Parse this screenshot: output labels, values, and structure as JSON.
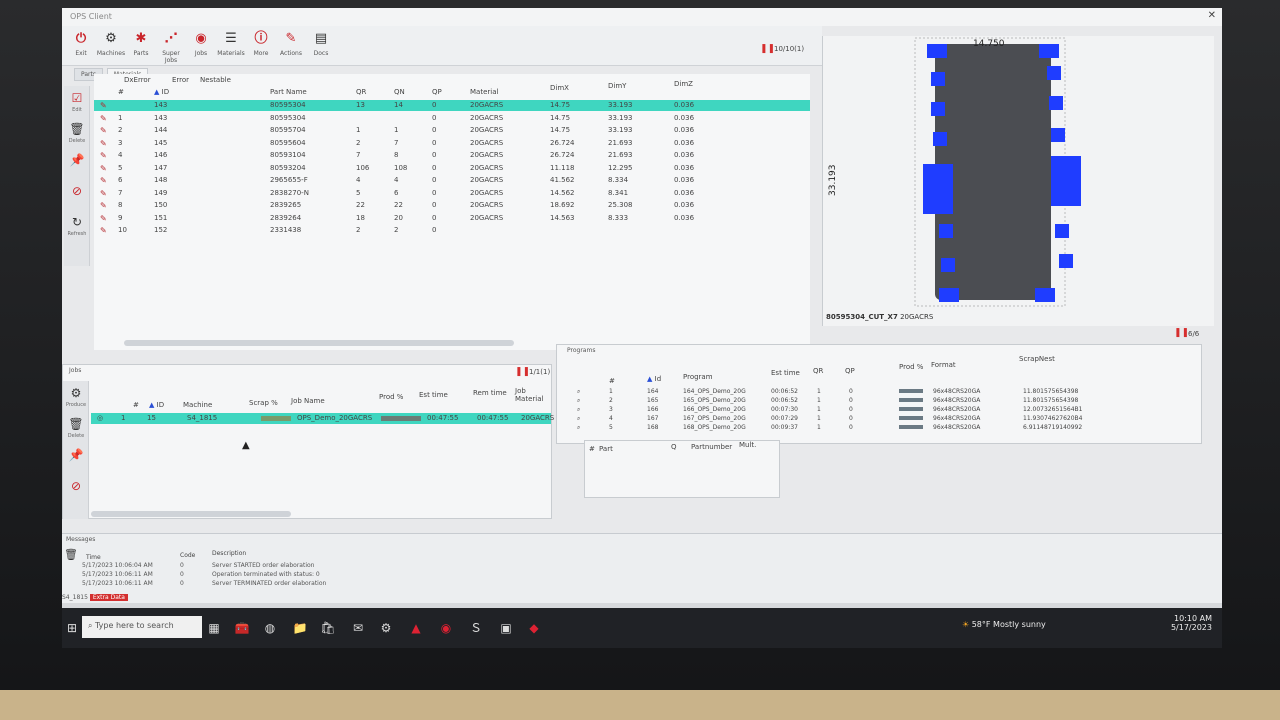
{
  "titlebar": {
    "title": "OPS Client"
  },
  "toolbar": {
    "buttons": [
      {
        "label": "Exit",
        "icon": "power-icon"
      },
      {
        "label": "Machines",
        "icon": "machines-icon"
      },
      {
        "label": "Parts",
        "icon": "parts-icon"
      },
      {
        "label": "Super Jobs",
        "icon": "superjobs-icon"
      },
      {
        "label": "Jobs",
        "icon": "jobs-icon"
      },
      {
        "label": "Materials",
        "icon": "materials-icon"
      },
      {
        "label": "More",
        "icon": "more-icon"
      },
      {
        "label": "Actions",
        "icon": "actions-icon"
      },
      {
        "label": "Docs",
        "icon": "docs-icon"
      }
    ]
  },
  "parts": {
    "tabs": [
      "Parts",
      "Materials"
    ],
    "filters": [
      "DxError",
      "Error",
      "Nestable"
    ],
    "counter": "10/10(1)",
    "columns": [
      "#",
      "ID",
      "Part Name",
      "QR",
      "QN",
      "QP",
      "Material",
      "DimX",
      "DimY",
      "DimZ"
    ],
    "rows": [
      {
        "n": "",
        "id": "143",
        "name": "80595304",
        "qr": "13",
        "qn": "14",
        "qp": "0",
        "mat": "20GACRS",
        "dx": "14.75",
        "dy": "33.193",
        "dz": "0.036"
      },
      {
        "n": "1",
        "id": "143",
        "name": "80595304",
        "qr": "",
        "qn": "",
        "qp": "0",
        "mat": "20GACRS",
        "dx": "14.75",
        "dy": "33.193",
        "dz": "0.036"
      },
      {
        "n": "2",
        "id": "144",
        "name": "80595704",
        "qr": "1",
        "qn": "1",
        "qp": "0",
        "mat": "20GACRS",
        "dx": "14.75",
        "dy": "33.193",
        "dz": "0.036"
      },
      {
        "n": "3",
        "id": "145",
        "name": "80595604",
        "qr": "2",
        "qn": "7",
        "qp": "0",
        "mat": "20GACRS",
        "dx": "26.724",
        "dy": "21.693",
        "dz": "0.036"
      },
      {
        "n": "4",
        "id": "146",
        "name": "80593104",
        "qr": "7",
        "qn": "8",
        "qp": "0",
        "mat": "20GACRS",
        "dx": "26.724",
        "dy": "21.693",
        "dz": "0.036"
      },
      {
        "n": "5",
        "id": "147",
        "name": "80593204",
        "qr": "106",
        "qn": "108",
        "qp": "0",
        "mat": "20GACRS",
        "dx": "11.118",
        "dy": "12.295",
        "dz": "0.036"
      },
      {
        "n": "6",
        "id": "148",
        "name": "2965655-F",
        "qr": "4",
        "qn": "4",
        "qp": "0",
        "mat": "20GACRS",
        "dx": "41.562",
        "dy": "8.334",
        "dz": "0.036"
      },
      {
        "n": "7",
        "id": "149",
        "name": "2838270-N",
        "qr": "5",
        "qn": "6",
        "qp": "0",
        "mat": "20GACRS",
        "dx": "14.562",
        "dy": "8.341",
        "dz": "0.036"
      },
      {
        "n": "8",
        "id": "150",
        "name": "2839265",
        "qr": "22",
        "qn": "22",
        "qp": "0",
        "mat": "20GACRS",
        "dx": "18.692",
        "dy": "25.308",
        "dz": "0.036"
      },
      {
        "n": "9",
        "id": "151",
        "name": "2839264",
        "qr": "18",
        "qn": "20",
        "qp": "0",
        "mat": "20GACRS",
        "dx": "14.563",
        "dy": "8.333",
        "dz": "0.036"
      },
      {
        "n": "10",
        "id": "152",
        "name": "2331438",
        "qr": "2",
        "qn": "2",
        "qp": "0",
        "mat": "",
        "dx": "",
        "dy": "",
        "dz": ""
      }
    ]
  },
  "preview": {
    "width_label": "14.750",
    "height_label": "33.193",
    "caption": "80595304_CUT_X7",
    "material": "20GACRS",
    "counter": "6/6"
  },
  "jobs": {
    "tab": "Jobs",
    "counter": "1/1(1)",
    "columns": [
      "#",
      "ID",
      "Machine",
      "Scrap %",
      "Job Name",
      "Prod %",
      "Est time",
      "Rem time",
      "Job Material"
    ],
    "rows": [
      {
        "n": "1",
        "id": "15",
        "machine": "S4_1815",
        "scrap": "",
        "name": "OPS_Demo_20GACRS",
        "prod": "",
        "est": "00:47:55",
        "rem": "00:47:55",
        "mat": "20GACRS"
      }
    ]
  },
  "programs": {
    "tab": "Programs",
    "columns": [
      "#",
      "Id",
      "Program",
      "Est time",
      "QR",
      "QP",
      "Prod %",
      "Format",
      "ScrapNest"
    ],
    "rows": [
      {
        "n": "1",
        "id": "164",
        "program": "164_OPS_Demo_20G",
        "est": "00:06:52",
        "qr": "1",
        "qp": "0",
        "format": "96x48CRS20GA",
        "scrap": "11.801575654398"
      },
      {
        "n": "2",
        "id": "165",
        "program": "165_OPS_Demo_20G",
        "est": "00:06:52",
        "qr": "1",
        "qp": "0",
        "format": "96x48CRS20GA",
        "scrap": "11.801575654398"
      },
      {
        "n": "3",
        "id": "166",
        "program": "166_OPS_Demo_20G",
        "est": "00:07:30",
        "qr": "1",
        "qp": "0",
        "format": "96x48CRS20GA",
        "scrap": "12.00732651564B1"
      },
      {
        "n": "4",
        "id": "167",
        "program": "167_OPS_Demo_20G",
        "est": "00:07:29",
        "qr": "1",
        "qp": "0",
        "format": "96x48CRS20GA",
        "scrap": "11.93074627620B4"
      },
      {
        "n": "5",
        "id": "168",
        "program": "168_OPS_Demo_20G",
        "est": "00:09:37",
        "qr": "1",
        "qp": "0",
        "format": "96x48CRS20GA",
        "scrap": "6.91148719140992"
      }
    ]
  },
  "partlist": {
    "columns": [
      "#",
      "Part",
      "Q",
      "Partnumber",
      "Mult."
    ]
  },
  "messages": {
    "tab": "Messages",
    "columns": [
      "Time",
      "Code",
      "Description"
    ],
    "rows": [
      {
        "time": "5/17/2023 10:06:04 AM",
        "code": "0",
        "desc": "Server STARTED order elaboration"
      },
      {
        "time": "5/17/2023 10:06:11 AM",
        "code": "0",
        "desc": "Operation terminated with status: 0"
      },
      {
        "time": "5/17/2023 10:06:11 AM",
        "code": "0",
        "desc": "Server TERMINATED order elaboration"
      }
    ]
  },
  "status": {
    "left": "S4_1815",
    "badge": "Extra Data"
  },
  "taskbar": {
    "search_placeholder": "Type here to search",
    "weather": "58°F  Mostly sunny",
    "time": "10:10 AM",
    "date": "5/17/2023"
  }
}
